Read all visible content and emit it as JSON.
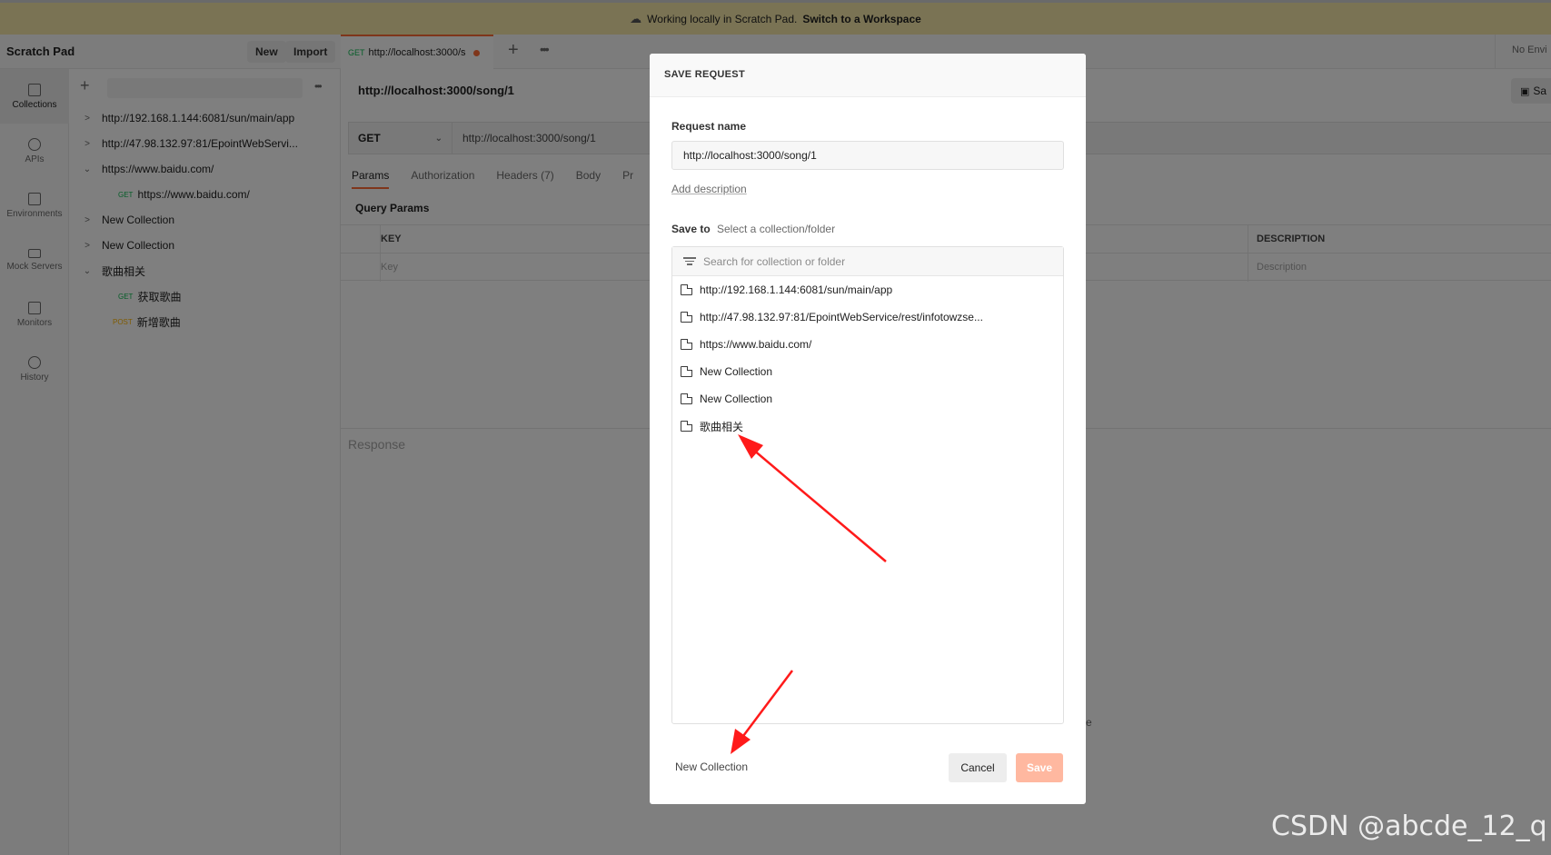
{
  "banner": {
    "text": "Working locally in Scratch Pad.",
    "link": "Switch to a Workspace"
  },
  "topbar": {
    "title": "Scratch Pad",
    "new_label": "New",
    "import_label": "Import",
    "env_label": "No Envi"
  },
  "tab": {
    "method": "GET",
    "label": "http://localhost:3000/s"
  },
  "rail": [
    {
      "label": "Collections",
      "icon": "collections-icon"
    },
    {
      "label": "APIs",
      "icon": "apis-icon"
    },
    {
      "label": "Environments",
      "icon": "environments-icon"
    },
    {
      "label": "Mock Servers",
      "icon": "mock-servers-icon"
    },
    {
      "label": "Monitors",
      "icon": "monitors-icon"
    },
    {
      "label": "History",
      "icon": "history-icon"
    }
  ],
  "sidebar": {
    "items": [
      {
        "chev": ">",
        "label": "http://192.168.1.144:6081/sun/main/app"
      },
      {
        "chev": ">",
        "label": "http://47.98.132.97:81/EpointWebServi..."
      },
      {
        "chev": "v",
        "label": "https://www.baidu.com/"
      },
      {
        "method": "GET",
        "label": "https://www.baidu.com/"
      },
      {
        "chev": ">",
        "label": "New Collection"
      },
      {
        "chev": ">",
        "label": "New Collection"
      },
      {
        "chev": "v",
        "label": "歌曲相关"
      },
      {
        "method": "GET",
        "label": "获取歌曲"
      },
      {
        "method": "POST",
        "label": "新增歌曲"
      }
    ]
  },
  "main": {
    "url_title": "http://localhost:3000/song/1",
    "save_label": "Sa",
    "method": "GET",
    "url": "http://localhost:3000/song/1",
    "tabs": [
      "Params",
      "Authorization",
      "Headers (7)",
      "Body",
      "Pr"
    ],
    "query_params": "Query Params",
    "key_header": "KEY",
    "desc_header": "DESCRIPTION",
    "key_placeholder": "Key",
    "desc_placeholder": "Description",
    "response": "Response",
    "partial_e": "e"
  },
  "modal": {
    "title": "SAVE REQUEST",
    "name_label": "Request name",
    "name_value": "http://localhost:3000/song/1",
    "add_description": "Add description",
    "save_to": "Save to",
    "save_to_hint": "Select a collection/folder",
    "search_placeholder": "Search for collection or folder",
    "collections": [
      "http://192.168.1.144:6081/sun/main/app",
      "http://47.98.132.97:81/EpointWebService/rest/infotowzse...",
      "https://www.baidu.com/",
      "New Collection",
      "New Collection",
      "歌曲相关"
    ],
    "new_collection": "New Collection",
    "cancel": "Cancel",
    "save": "Save"
  },
  "watermark": "CSDN @abcde_12_q",
  "colors": {
    "accent": "#ff6c37",
    "banner": "#f4e7a9",
    "annotation_arrow": "#ff1a1a"
  }
}
